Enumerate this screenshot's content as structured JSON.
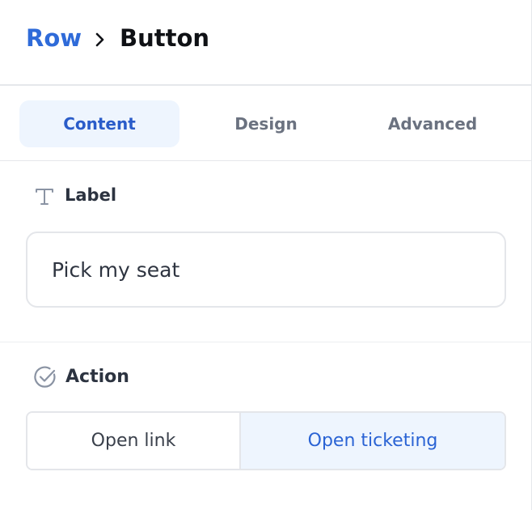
{
  "breadcrumb": {
    "parent": "Row",
    "current": "Button",
    "separator_icon": "chevron-right-icon"
  },
  "tabs": [
    {
      "label": "Content",
      "active": true
    },
    {
      "label": "Design",
      "active": false
    },
    {
      "label": "Advanced",
      "active": false
    }
  ],
  "label_section": {
    "title": "Label",
    "icon": "text-type-icon",
    "input_value": "Pick my seat"
  },
  "action_section": {
    "title": "Action",
    "icon": "check-circle-icon",
    "options": [
      {
        "label": "Open link",
        "selected": false
      },
      {
        "label": "Open ticketing",
        "selected": true
      }
    ]
  },
  "colors": {
    "accent": "#2f6bd9",
    "active_tab_bg": "#eef5fe",
    "text_dark": "#0f1115",
    "text_muted": "#6b7280",
    "border": "#e4e6ea"
  }
}
